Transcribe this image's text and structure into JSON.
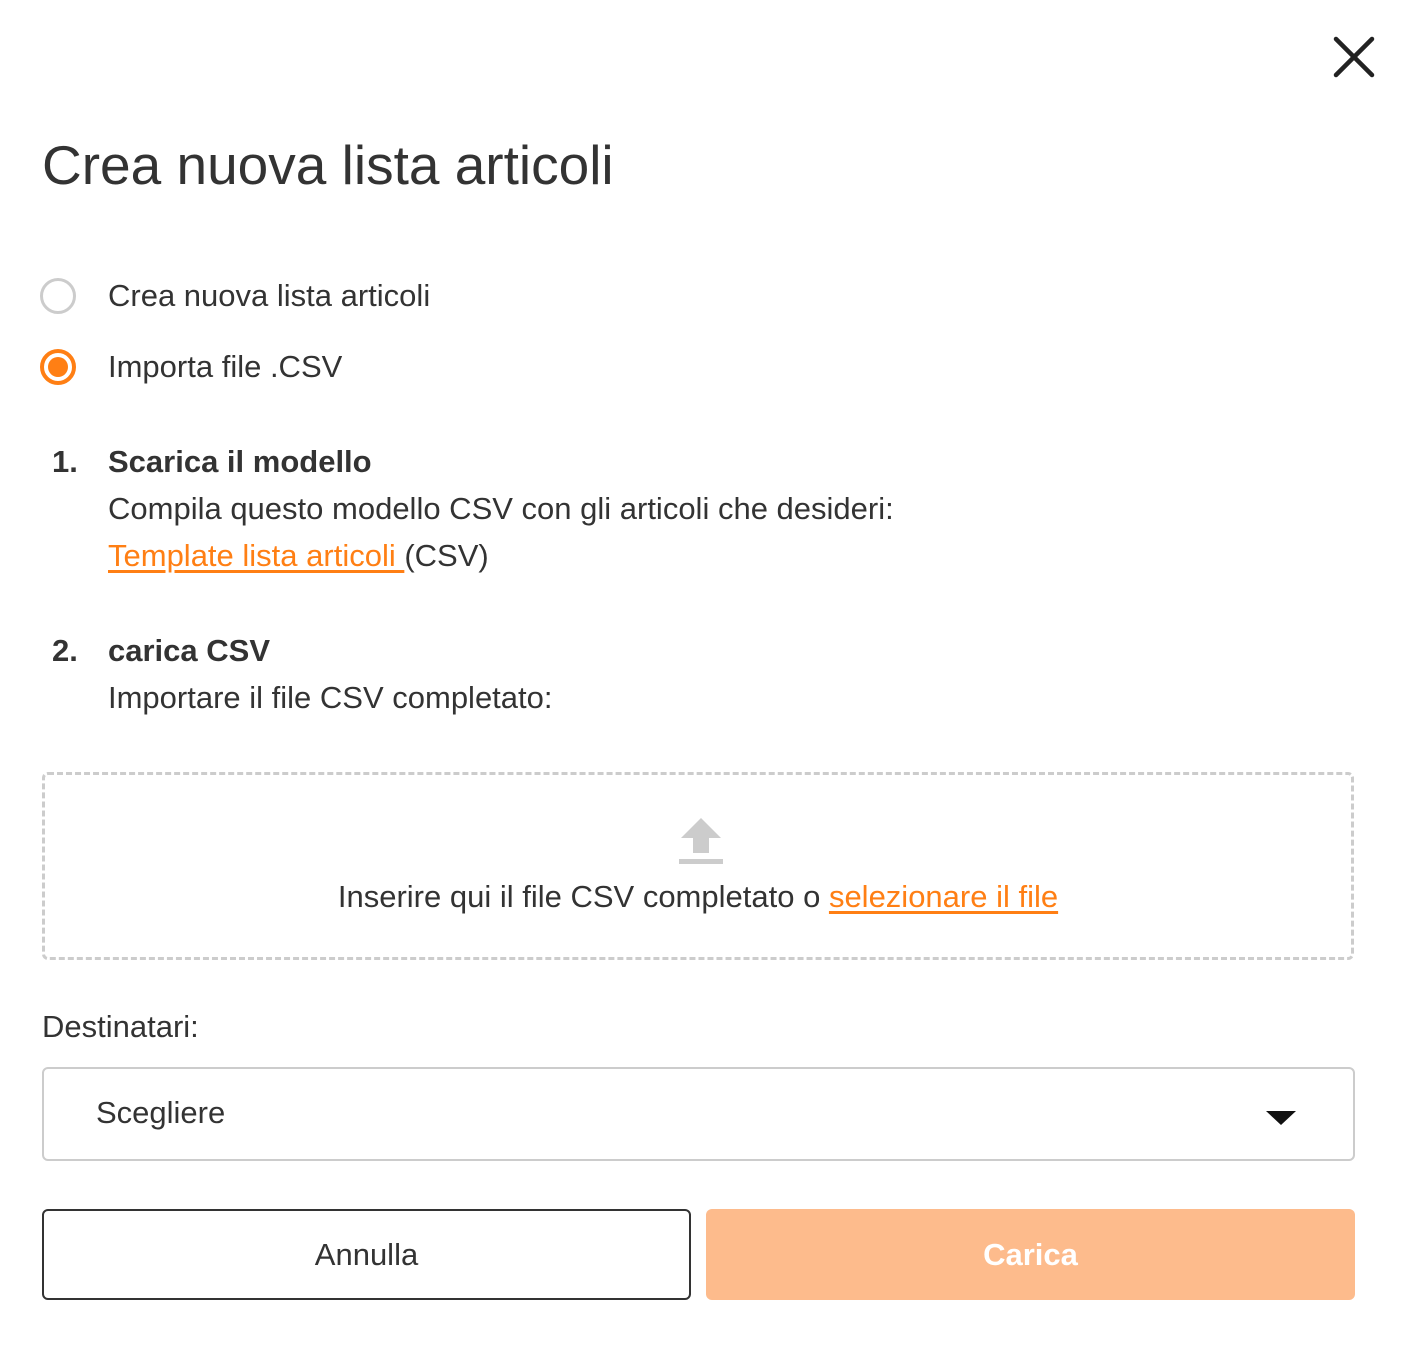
{
  "dialog": {
    "title": "Crea nuova lista articoli",
    "close_icon": "close-icon"
  },
  "options": [
    {
      "label": "Crea nuova lista articoli",
      "selected": false
    },
    {
      "label": "Importa file .CSV",
      "selected": true
    }
  ],
  "steps": [
    {
      "number": "1.",
      "title": "Scarica il modello",
      "description": "Compila questo modello CSV con gli articoli che desideri:",
      "link_text": "Template lista articoli ",
      "link_suffix": "(CSV)"
    },
    {
      "number": "2.",
      "title": "carica CSV",
      "description": "Importare il file CSV completato:"
    }
  ],
  "dropzone": {
    "icon": "upload-icon",
    "text": "Inserire qui il file CSV completato o ",
    "link_text": "selezionare il file"
  },
  "recipients": {
    "label": "Destinatari:",
    "placeholder": "Scegliere",
    "caret_icon": "caret-down-icon"
  },
  "buttons": {
    "cancel": "Annulla",
    "upload": "Carica"
  },
  "colors": {
    "accent": "#ff7f14",
    "upload_disabled_bg": "#fdbb8c",
    "border": "#cccccc",
    "text": "#333333"
  }
}
